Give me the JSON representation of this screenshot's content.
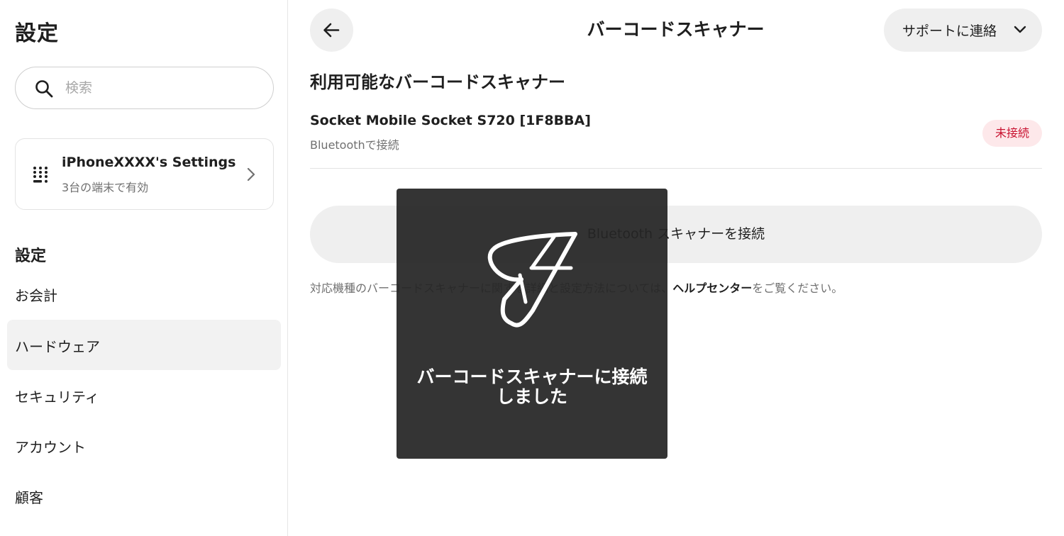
{
  "sidebar": {
    "title": "設定",
    "search": {
      "placeholder": "検索",
      "value": ""
    },
    "device_card": {
      "name": "iPhoneXXXX's Settings",
      "subtitle": "3台の端末で有効"
    },
    "section_title": "設定",
    "items": [
      {
        "label": "お会計"
      },
      {
        "label": "ハードウェア",
        "active": true
      },
      {
        "label": "セキュリティ"
      },
      {
        "label": "アカウント"
      },
      {
        "label": "顧客"
      }
    ]
  },
  "header": {
    "title": "バーコードスキャナー",
    "support_label": "サポートに連絡"
  },
  "main": {
    "available_title": "利用可能なバーコードスキャナー",
    "scanner": {
      "name": "Socket Mobile Socket S720 [1F8BBA]",
      "connection": "Bluetoothで接続",
      "status": "未接続"
    },
    "connect_button_label": "Bluetooth スキャナーを接続",
    "help_text_before": "対応機種のバーコードスキャナーに関する詳細と設定方法については、",
    "help_link": "ヘルプセンター",
    "help_text_after": "をご覧ください。"
  },
  "toast": {
    "message": "バーコードスキャナーに接続しました"
  },
  "colors": {
    "status_badge_bg": "#fde8ea",
    "status_badge_text": "#c8102e",
    "toast_bg": "#252525"
  }
}
